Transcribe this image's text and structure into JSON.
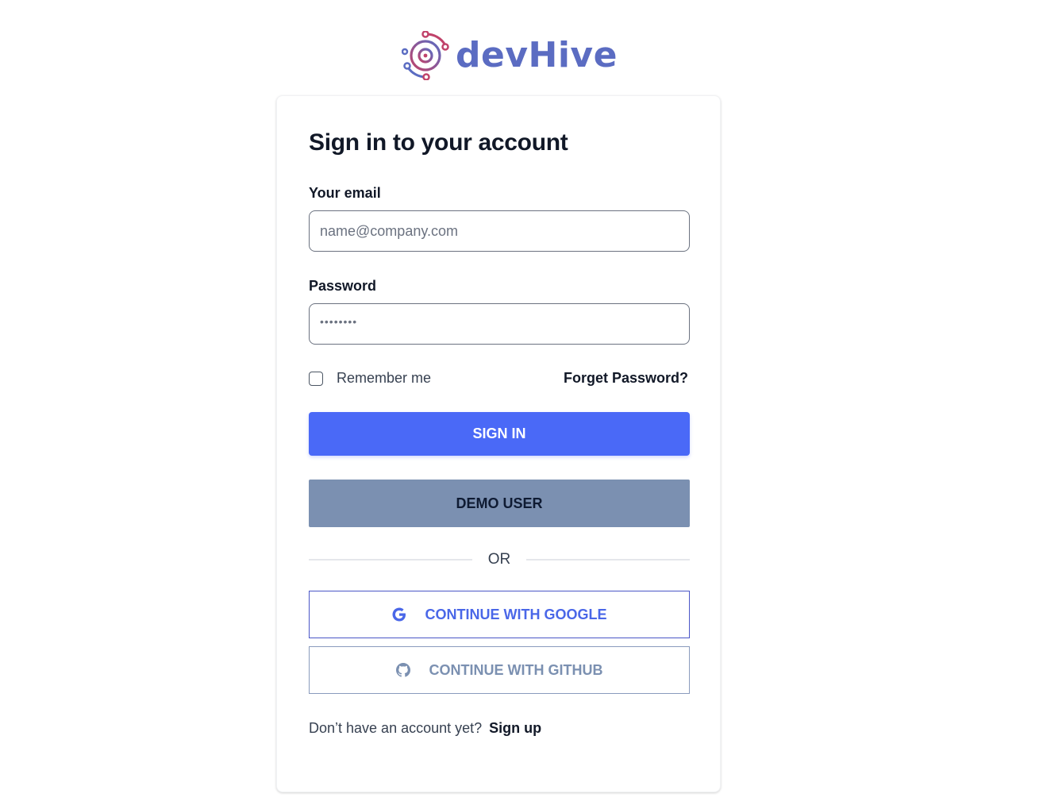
{
  "brand": {
    "name": "devHive",
    "text_color": "#5b6cc2",
    "icon_colors": [
      "#c0426a",
      "#5b6cc2"
    ]
  },
  "form": {
    "title": "Sign in to your account",
    "email_label": "Your email",
    "email_placeholder": "name@company.com",
    "email_value": "",
    "password_label": "Password",
    "password_masked": "••••••••",
    "remember_label": "Remember me",
    "remember_checked": false,
    "forgot_label": "Forget Password?",
    "signin_label": "SIGN IN",
    "demo_label": "DEMO USER",
    "divider_label": "OR",
    "google_label": "CONTINUE WITH GOOGLE",
    "github_label": "CONTINUE WITH GITHUB",
    "signup_prompt": "Don’t have an account yet?",
    "signup_link": "Sign up"
  },
  "colors": {
    "primary": "#4a69f7",
    "demo": "#7b90b1",
    "google": "#4a67e8",
    "github": "#7b90b1"
  },
  "icons": {
    "brand": "devhive-logo-icon",
    "google": "google-icon",
    "github": "github-icon"
  }
}
